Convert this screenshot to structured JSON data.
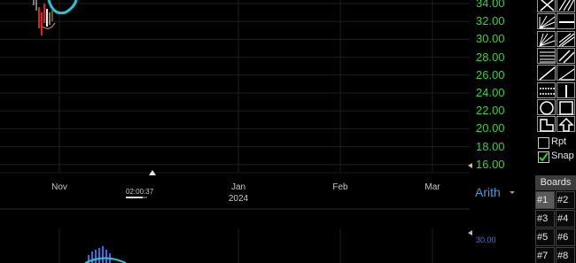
{
  "price_axis": {
    "labels": [
      "34.00",
      "32.00",
      "30.00",
      "28.00",
      "26.00",
      "24.00",
      "22.00",
      "20.00",
      "18.00",
      "16.00"
    ],
    "color": "#33d633"
  },
  "time_axis": {
    "months": [
      {
        "label": "Nov"
      },
      {
        "label": "Jan",
        "year": "2024"
      },
      {
        "label": "Feb"
      },
      {
        "label": "Mar"
      }
    ]
  },
  "timer": {
    "text": "02:00:37",
    "progress": 0.8
  },
  "scale_mode": {
    "label": "Arith"
  },
  "lower_panel": {
    "axis_label": "30.00"
  },
  "drawing_tools": [
    {
      "name": "cross-lines-icon"
    },
    {
      "name": "parallel-diagonals-icon"
    },
    {
      "name": "fan-lines-icon"
    },
    {
      "name": "horizontal-line-icon"
    },
    {
      "name": "gann-fan-icon"
    },
    {
      "name": "diagonal-fan-icon"
    },
    {
      "name": "horizontal-levels-icon"
    },
    {
      "name": "channel-icon"
    },
    {
      "name": "trendline-icon"
    },
    {
      "name": "ray-icon"
    },
    {
      "name": "dotted-levels-icon"
    },
    {
      "name": "vertical-line-icon"
    },
    {
      "name": "circle-icon"
    },
    {
      "name": "square-icon"
    },
    {
      "name": "step-shape-icon"
    },
    {
      "name": "up-arrow-icon"
    }
  ],
  "options": {
    "repeat": {
      "label": "Rpt",
      "checked": false
    },
    "snap": {
      "label": "Snap",
      "checked": true
    }
  },
  "boards": {
    "header": "Boards",
    "items": [
      "#1",
      "#2",
      "#3",
      "#4",
      "#5",
      "#6",
      "#7",
      "#8"
    ],
    "active": "#1"
  }
}
